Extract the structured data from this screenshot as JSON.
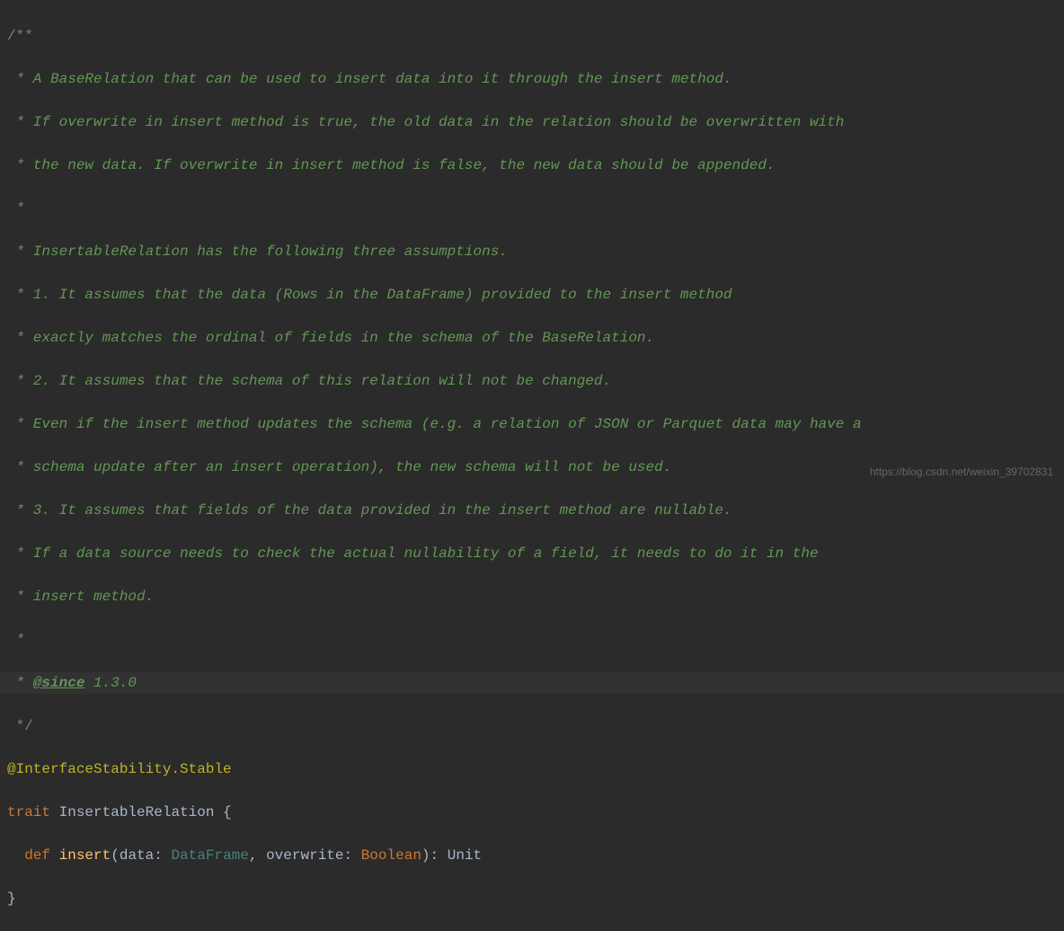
{
  "code": {
    "comment_start": "/**",
    "line1": " * A BaseRelation that can be used to insert data into it through the insert method.",
    "line2": " * If overwrite in insert method is true, the old data in the relation should be overwritten with",
    "line3": " * the new data. If overwrite in insert method is false, the new data should be appended.",
    "line4": " *",
    "line5": " * InsertableRelation has the following three assumptions.",
    "line6": " * 1. It assumes that the data (Rows in the DataFrame) provided to the insert method",
    "line7": " * exactly matches the ordinal of fields in the schema of the BaseRelation.",
    "line8": " * 2. It assumes that the schema of this relation will not be changed.",
    "line9": " * Even if the insert method updates the schema (e.g. a relation of JSON or Parquet data may have a",
    "line10": " * schema update after an insert operation), the new schema will not be used.",
    "line11": " * 3. It assumes that fields of the data provided in the insert method are nullable.",
    "line12": " * If a data source needs to check the actual nullability of a field, it needs to do it in the",
    "line13": " * insert method.",
    "line14": " *",
    "since_prefix": " * ",
    "since_tag": "@since",
    "since_version": " 1.3.0",
    "comment_end": " */",
    "annotation": "@InterfaceStability.Stable",
    "trait_keyword": "trait",
    "trait_name": " InsertableRelation ",
    "open_brace": "{",
    "def_indent": "  ",
    "def_keyword": "def",
    "method_name": " insert",
    "open_paren": "(",
    "param1_name": "data",
    "colon1": ": ",
    "param1_type": "DataFrame",
    "comma": ", ",
    "param2_name": "overwrite",
    "colon2": ": ",
    "param2_type": "Boolean",
    "close_paren": ")",
    "return_colon": ": ",
    "return_type": "Unit",
    "close_brace": "}"
  },
  "watermark": "https://blog.csdn.net/weixin_39702831"
}
